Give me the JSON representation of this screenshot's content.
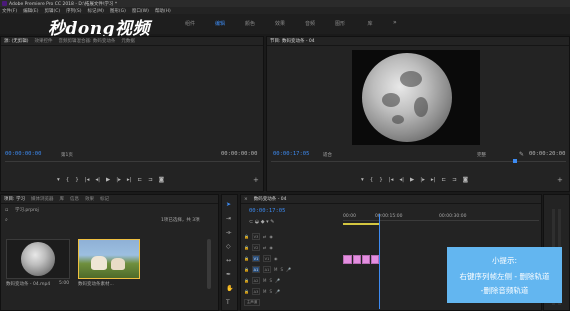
{
  "window": {
    "title": "Adobe Premiere Pro CC 2018 - D:\\拓展文件\\学习 *"
  },
  "menu": [
    "文件(F)",
    "编辑(E)",
    "剪辑(C)",
    "序列(S)",
    "标记(M)",
    "图形(G)",
    "窗口(W)",
    "帮助(H)"
  ],
  "watermark": "秒dong视频",
  "workspace_tabs": [
    "组件",
    "编辑",
    "颜色",
    "效果",
    "音频",
    "图形",
    "库"
  ],
  "workspace_more": "»",
  "source": {
    "tabs": [
      "源: (无剪辑)",
      "效果控件",
      "音频剪辑混合器: 数码变动条",
      "元数据"
    ],
    "timecode_left": "00:00:00:00",
    "page_label": "第1页",
    "timecode_right": "00:00:00:00"
  },
  "program": {
    "tab": "节目: 数码变动条 - 04",
    "timecode_left": "00:00:17:05",
    "fit": "适合",
    "quality": "完整",
    "timecode_right": "00:00:20:00"
  },
  "project": {
    "tabs": [
      "项目: 学习",
      "媒体浏览器",
      "库",
      "信息",
      "效果",
      "标记"
    ],
    "file": "学习.prproj",
    "count": "1项已选择，共 3项",
    "items": [
      {
        "label": "数码变动条 - 04.mp4",
        "duration": "5:00"
      },
      {
        "label": "数码变动条素材...",
        "duration": ""
      }
    ]
  },
  "timeline": {
    "tab": "数码变动条 - 04",
    "timecode": "00:00:17:05",
    "ruler": [
      "00:00",
      "00:00:15:00",
      "00:00:30:00"
    ],
    "tracks": [
      {
        "name": "V3",
        "row_label": ""
      },
      {
        "name": "V2",
        "row_label": ""
      },
      {
        "name": "V1",
        "row_label": "V1"
      },
      {
        "name": "A1",
        "row_label": "A1"
      },
      {
        "name": "A2",
        "row_label": ""
      },
      {
        "name": "A3",
        "row_label": ""
      },
      {
        "name": "主声道",
        "row_label": ""
      }
    ]
  },
  "hint": {
    "title": "小提示:",
    "line1": "右键序列帧左侧 - 删除轨道",
    "line2": "-删除音频轨道"
  },
  "colors": {
    "accent": "#3d8bf2",
    "clip": "#e48ee0",
    "hint_bg": "#63b6f0"
  }
}
